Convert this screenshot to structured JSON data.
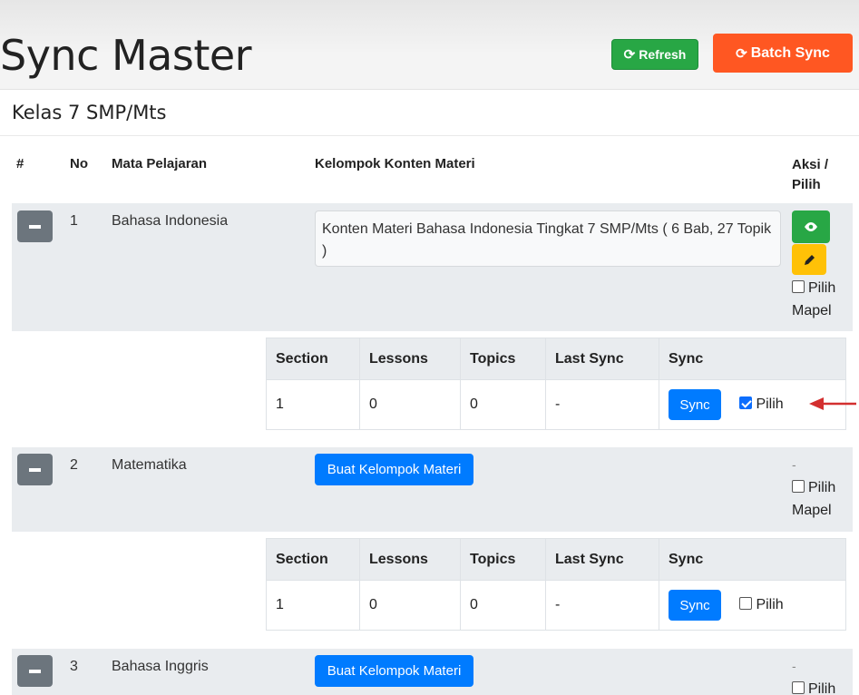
{
  "header": {
    "title": "Sync Master",
    "refresh_label": "Refresh",
    "batch_sync_label": "Batch Sync"
  },
  "card": {
    "title": "Kelas 7 SMP/Mts",
    "columns": {
      "hash": "#",
      "no": "No",
      "mapel": "Mata Pelajaran",
      "kelompok": "Kelompok Konten Materi",
      "aksi_line1": "Aksi /",
      "aksi_line2": "Pilih"
    }
  },
  "subtable_columns": [
    "Section",
    "Lessons",
    "Topics",
    "Last Sync",
    "Sync"
  ],
  "rows": [
    {
      "no": "1",
      "mapel": "Bahasa Indonesia",
      "konten": "Konten Materi Bahasa Indonesia Tingkat 7 SMP/Mts ( 6 Bab, 27 Topik )",
      "pilih_mapel_line1": "Pilih",
      "pilih_mapel_line2": "Mapel",
      "pilih_mapel_checked": false,
      "sub": {
        "section": "1",
        "lessons": "0",
        "topics": "0",
        "last_sync": "-",
        "sync_label": "Sync",
        "pilih_label": "Pilih",
        "pilih_checked": true
      }
    },
    {
      "no": "2",
      "mapel": "Matematika",
      "buat_label": "Buat Kelompok Materi",
      "aksi_dash": "-",
      "pilih_mapel_line1": "Pilih",
      "pilih_mapel_line2": "Mapel",
      "pilih_mapel_checked": false,
      "sub": {
        "section": "1",
        "lessons": "0",
        "topics": "0",
        "last_sync": "-",
        "sync_label": "Sync",
        "pilih_label": "Pilih",
        "pilih_checked": false
      }
    },
    {
      "no": "3",
      "mapel": "Bahasa Inggris",
      "buat_label": "Buat Kelompok Materi",
      "aksi_dash": "-",
      "pilih_mapel_line1": "Pilih",
      "pilih_mapel_checked": false
    }
  ],
  "colors": {
    "refresh": "#28a745",
    "batch_sync": "#ff5722",
    "primary": "#007bff",
    "warning": "#ffc107",
    "arrow": "#d32f2f"
  }
}
